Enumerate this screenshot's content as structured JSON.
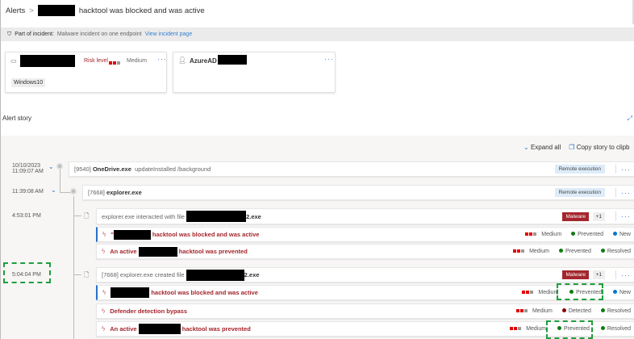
{
  "breadcrumb": {
    "root": "Alerts",
    "separator": ">",
    "title": "hacktool was blocked and was active"
  },
  "incident": {
    "label": "Part of incident:",
    "name": "Malware incident on one endpoint",
    "link": "View incident page"
  },
  "device_card": {
    "risk_label": "Risk level",
    "risk_value": "Medium",
    "os_tag": "Windows10",
    "menu": "···"
  },
  "user_card": {
    "name_prefix": "AzureAD",
    "menu": "···"
  },
  "story": {
    "title": "Alert story",
    "expand_all": "Expand all",
    "copy": "Copy story to clipb"
  },
  "colors": {
    "severity_red": "#e00000",
    "prevented": "#107c10",
    "detected": "#8b0000",
    "new": "#0078d4",
    "malware": "#a4262c"
  },
  "rows": [
    {
      "time": "10/10/2023",
      "time2": "11:09:07 AM",
      "pid": "[9540]",
      "process": "OneDrive.exe",
      "args": "updateInstalled /background",
      "tag": "Remote execution"
    },
    {
      "time": "11:39:08 AM",
      "pid": "[7668]",
      "process": "explorer.exe",
      "tag": "Remote execution"
    },
    {
      "time": "4:53:01 PM",
      "text": "explorer.exe interacted with file",
      "suffix": "2.exe",
      "tag": "Malware",
      "extra": "+1"
    },
    {
      "time": "5:04:04 PM",
      "text": "[7668] explorer.exe created file",
      "suffix": "2.exe",
      "tag": "Malware",
      "extra": "+1"
    }
  ],
  "alerts": [
    {
      "prefix": "\"",
      "title": "hacktool was blocked and was active",
      "severity": "Medium",
      "detection": "Prevented",
      "status": "New"
    },
    {
      "prefix": "An active",
      "title": "hacktool was prevented",
      "severity": "Medium",
      "detection": "Prevented",
      "status": "Resolved"
    },
    {
      "prefix": "",
      "title": "hacktool was blocked and was active",
      "severity": "Medium",
      "detection": "Prevented",
      "status": "New"
    },
    {
      "prefix": "",
      "title": "Defender detection bypass",
      "severity": "Medium",
      "detection": "Detected",
      "status": "Resolved"
    },
    {
      "prefix": "An active",
      "title": "hacktool was prevented",
      "severity": "Medium",
      "detection": "Prevented",
      "status": "Resolved"
    }
  ]
}
